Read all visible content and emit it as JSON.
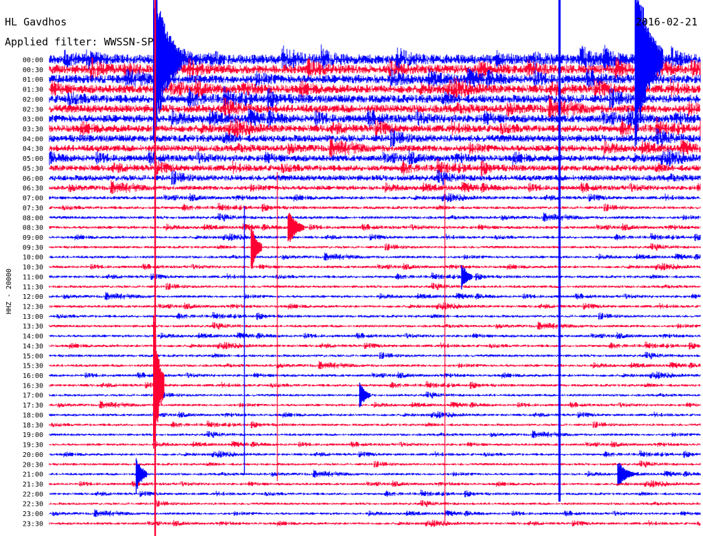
{
  "header": {
    "station": "HL Gavdhos",
    "date": "2016-02-21",
    "filter_text": "Applied filter: WWSSN-SP",
    "channel_label": "HHZ - 20000"
  },
  "colors": {
    "background": "#ffffff",
    "trace_a": "#0000ff",
    "trace_b": "#ff0033",
    "text": "#000000"
  },
  "chart_data": {
    "type": "helicorder",
    "title": "HL Gavdhos",
    "date": "2016-02-21",
    "filter": "WWSSN-SP",
    "channel": "HHZ",
    "scale": "20000",
    "row_labels": [
      "00:00",
      "00:30",
      "01:00",
      "01:30",
      "02:00",
      "02:30",
      "03:00",
      "03:30",
      "04:00",
      "04:30",
      "05:00",
      "05:30",
      "06:00",
      "06:30",
      "07:00",
      "07:30",
      "08:00",
      "08:30",
      "09:00",
      "09:30",
      "10:00",
      "10:30",
      "11:00",
      "11:30",
      "12:00",
      "12:30",
      "13:00",
      "13:30",
      "14:00",
      "14:30",
      "15:00",
      "15:30",
      "16:00",
      "16:30",
      "17:00",
      "17:30",
      "18:00",
      "18:30",
      "19:00",
      "19:30",
      "20:00",
      "20:30",
      "21:00",
      "21:30",
      "22:00",
      "22:30",
      "23:00",
      "23:30"
    ],
    "row_minutes": 30,
    "series_colors": [
      "#0000ff",
      "#ff0033"
    ],
    "noise_amplitude_by_row": [
      3.2,
      3.0,
      2.9,
      2.8,
      2.8,
      2.7,
      2.6,
      2.4,
      2.4,
      2.2,
      2.1,
      2.0,
      1.9,
      1.5,
      1.1,
      1.0,
      1.0,
      1.0,
      0.9,
      0.9,
      0.9,
      0.9,
      0.9,
      0.9,
      0.9,
      0.9,
      0.9,
      0.9,
      0.9,
      0.9,
      0.9,
      0.9,
      0.9,
      0.9,
      0.85,
      0.85,
      0.85,
      0.85,
      0.85,
      0.85,
      0.85,
      0.85,
      0.85,
      0.85,
      0.85,
      0.85,
      0.85,
      0.85
    ],
    "events": [
      {
        "row": 0,
        "minute_in_row": 4.8,
        "amplitude": 18,
        "duration_min": 23
      },
      {
        "row": 0,
        "minute_in_row": 27.0,
        "amplitude": 20,
        "duration_min": 6
      },
      {
        "row": 17,
        "minute_in_row": 11.0,
        "amplitude": 4,
        "duration_min": 3
      },
      {
        "row": 19,
        "minute_in_row": 9.3,
        "amplitude": 5,
        "duration_min": 2
      },
      {
        "row": 22,
        "minute_in_row": 19.0,
        "amplitude": 3,
        "duration_min": 2
      },
      {
        "row": 33,
        "minute_in_row": 4.8,
        "amplitude": 16,
        "duration_min": 2
      },
      {
        "row": 34,
        "minute_in_row": 14.3,
        "amplitude": 3,
        "duration_min": 2
      },
      {
        "row": 42,
        "minute_in_row": 4.0,
        "amplitude": 4,
        "duration_min": 2
      },
      {
        "row": 42,
        "minute_in_row": 26.2,
        "amplitude": 3,
        "duration_min": 3
      }
    ]
  }
}
